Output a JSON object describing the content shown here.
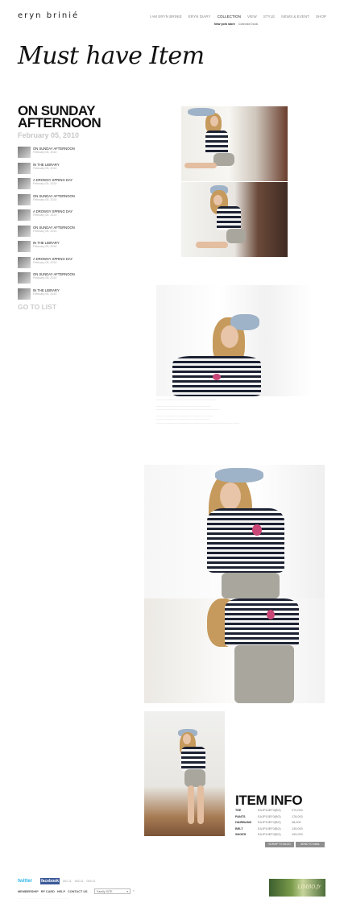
{
  "header": {
    "logo": "eryn brinié",
    "nav": [
      "I AM ERYN BRINIE",
      "ERYN DIARY",
      "COLLECTION",
      "VIEW",
      "STYLE",
      "NEWS & EVENT",
      "SHOP"
    ],
    "active_nav": "COLLECTION",
    "subnav": [
      "New york store",
      "Collection book"
    ]
  },
  "page_heading": "Must have Item",
  "post": {
    "title_line1": "ON SUNDAY",
    "title_line2": "AFTERNOON",
    "date": "February 05, 2010"
  },
  "post_list": [
    {
      "title": "ON SUNDAY AFTERNOON",
      "date": "February 05, 2010"
    },
    {
      "title": "IN THE LIBRARY",
      "date": "February 05, 2010"
    },
    {
      "title": "A DROWSY SPRING DAY",
      "date": "February 05, 2010"
    },
    {
      "title": "ON SUNDAY AFTERNOON",
      "date": "February 05, 2010"
    },
    {
      "title": "A DROWSY SPRING DAY",
      "date": "February 05, 2010"
    },
    {
      "title": "ON SUNDAY AFTERNOON",
      "date": "February 05, 2010"
    },
    {
      "title": "IN THE LIBRARY",
      "date": "February 05, 2010"
    },
    {
      "title": "A DROWSY SPRING DAY",
      "date": "February 05, 2010"
    },
    {
      "title": "ON SUNDAY AFTERNOON",
      "date": "February 05, 2010"
    },
    {
      "title": "IN THE LIBRARY",
      "date": "February 05, 2010"
    }
  ],
  "go_to_list": "GO TO LIST",
  "item_info": {
    "title": "ITEM INFO",
    "rows": [
      {
        "name": "TEE",
        "code": "EAJP10EF0(BG)",
        "price": "270,000"
      },
      {
        "name": "PANTS",
        "code": "EAJP10EF0(BG)",
        "price": "178,000"
      },
      {
        "name": "HAIRBAND",
        "code": "EAJP10EF0(BG)",
        "price": "48,000"
      },
      {
        "name": "BELT",
        "code": "EAJP10EF0(BG)",
        "price": "139,000"
      },
      {
        "name": "SHOES",
        "code": "EAJP10EF0(BG)",
        "price": "199,000"
      }
    ],
    "buttons": [
      "SCRAP TO BLOG",
      "SEND TO MAIL"
    ]
  },
  "footer": {
    "twitter": "twitter",
    "facebook": "facebook",
    "stats": [
      "001.11",
      "002.11",
      "003.11"
    ],
    "nav": [
      "MEMBERSHIP",
      "RF CARD",
      "HELP",
      "CONTACT US"
    ],
    "family_select": "Family SITE",
    "go": "»",
    "banner_text": "LIMBO.fr"
  },
  "colors": {
    "accent_twitter": "#2fb7e8",
    "accent_facebook": "#3b5998",
    "date_gray": "#c8c8c8"
  }
}
